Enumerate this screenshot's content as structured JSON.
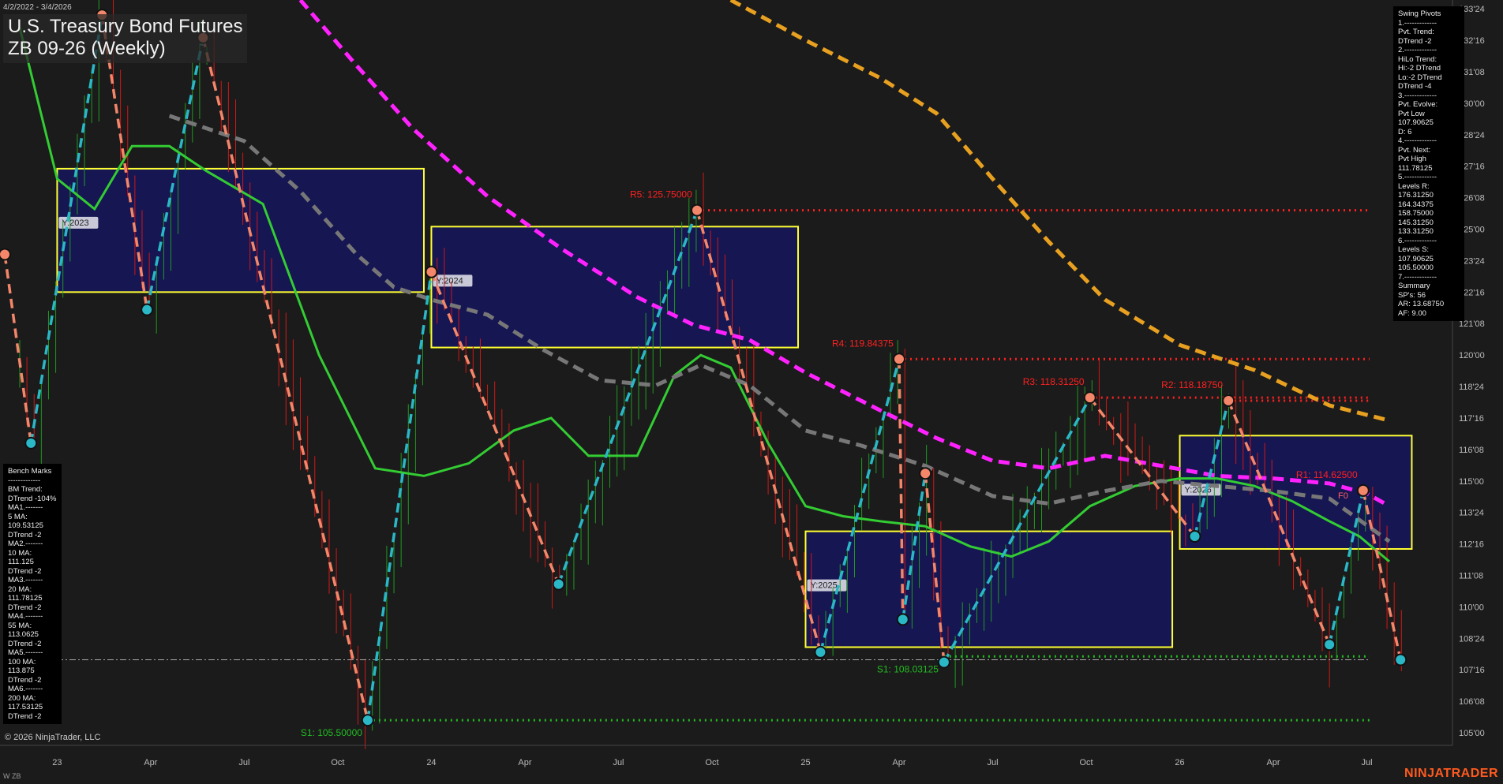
{
  "header": {
    "date_range": "4/2/2022 - 3/4/2026",
    "title_line1": "U.S. Treasury Bond Futures",
    "title_line2": "ZB 09-26 (Weekly)"
  },
  "swing_panel": {
    "lines": [
      "Swing Pivots",
      "1.-------------",
      "Pvt. Trend:",
      "DTrend -2",
      "2.-------------",
      "HiLo Trend:",
      "Hi:-2 DTrend",
      "Lo:-2 DTrend",
      "DTrend -4",
      "3.-------------",
      "Pvt. Evolve:",
      "Pvt Low",
      "107.90625",
      "D: 6",
      "4.-------------",
      "Pvt. Next:",
      "Pvt High",
      "111.78125",
      "5.-------------",
      "Levels R:",
      "176.31250",
      "164.34375",
      "158.75000",
      "145.31250",
      "133.31250",
      "6.-------------",
      "Levels S:",
      "107.90625",
      "105.50000",
      "7.-------------",
      "Summary",
      "SP's: 56",
      "AR: 13.68750",
      "AF: 9.00"
    ]
  },
  "bench_panel": {
    "lines": [
      "Bench Marks",
      "-------------",
      "BM Trend:",
      "DTrend -104%",
      "MA1.-------",
      "5 MA:",
      "109.53125",
      "DTrend -2",
      "MA2.-------",
      "10 MA:",
      "111.125",
      "DTrend -2",
      "MA3.-------",
      "20 MA:",
      "111.78125",
      "DTrend -2",
      "MA4.-------",
      "55 MA:",
      "113.0625",
      "DTrend -2",
      "MA5.-------",
      "100 MA:",
      "113.875",
      "DTrend -2",
      "MA6.-------",
      "200 MA:",
      "117.53125",
      "DTrend -2"
    ]
  },
  "footer": {
    "copyright": "© 2026 NinjaTrader, LLC",
    "instrument_code": "W ZB",
    "brand": "NINJATRADER"
  },
  "colors": {
    "background": "#1b1b1b",
    "up_swing": "#2ab7c6",
    "down_swing": "#f4866a",
    "ma_green": "#33cc33",
    "ma_gray": "#777777",
    "ma_magenta": "#ff22ff",
    "ma_orange": "#e8a020",
    "resistance": "#ff2020",
    "support": "#22bb22",
    "year_box": "#ffff33",
    "year_box_fill": "#16165a"
  },
  "chart_data": {
    "type": "line",
    "x_tick_labels": [
      "23",
      "Apr",
      "Jul",
      "Oct",
      "24",
      "Apr",
      "Jul",
      "Oct",
      "25",
      "Apr",
      "Jul",
      "Oct",
      "26",
      "Apr",
      "Jul"
    ],
    "y_tick_labels": [
      "133'24",
      "132'16",
      "131'08",
      "130'00",
      "128'24",
      "127'16",
      "126'08",
      "125'00",
      "123'24",
      "122'16",
      "121'08",
      "120'00",
      "118'24",
      "117'16",
      "116'08",
      "115'00",
      "113'24",
      "112'16",
      "111'08",
      "110'00",
      "108'24",
      "107'16",
      "106'08",
      "105'00"
    ],
    "ylim": [
      104.5,
      134.1
    ],
    "xlim": [
      2022.9,
      2026.56
    ],
    "swing_pivots": [
      {
        "x": 2022.86,
        "y": 124.0,
        "type": "high"
      },
      {
        "x": 2022.93,
        "y": 116.5,
        "type": "low"
      },
      {
        "x": 2023.12,
        "y": 133.5,
        "type": "high"
      },
      {
        "x": 2023.24,
        "y": 121.8,
        "type": "low"
      },
      {
        "x": 2023.39,
        "y": 132.6,
        "type": "high"
      },
      {
        "x": 2023.83,
        "y": 105.5,
        "type": "low"
      },
      {
        "x": 2024.0,
        "y": 123.3,
        "type": "high"
      },
      {
        "x": 2024.34,
        "y": 110.9,
        "type": "low"
      },
      {
        "x": 2024.71,
        "y": 125.75,
        "type": "high"
      },
      {
        "x": 2025.04,
        "y": 108.2,
        "type": "low"
      },
      {
        "x": 2025.25,
        "y": 119.84,
        "type": "high"
      },
      {
        "x": 2025.26,
        "y": 109.5,
        "type": "low"
      },
      {
        "x": 2025.32,
        "y": 115.3,
        "type": "high"
      },
      {
        "x": 2025.37,
        "y": 107.8,
        "type": "low"
      },
      {
        "x": 2025.76,
        "y": 118.31,
        "type": "high"
      },
      {
        "x": 2026.04,
        "y": 112.8,
        "type": "low"
      },
      {
        "x": 2026.13,
        "y": 118.19,
        "type": "high"
      },
      {
        "x": 2026.4,
        "y": 108.5,
        "type": "low"
      },
      {
        "x": 2026.49,
        "y": 114.62,
        "type": "high"
      },
      {
        "x": 2026.59,
        "y": 107.9,
        "type": "low"
      }
    ],
    "moving_averages": [
      {
        "name": "MA green",
        "color": "#33cc33",
        "dash": false,
        "points": [
          [
            2022.9,
            133
          ],
          [
            2023.0,
            127
          ],
          [
            2023.1,
            125.8
          ],
          [
            2023.2,
            128.3
          ],
          [
            2023.3,
            128.3
          ],
          [
            2023.4,
            127.3
          ],
          [
            2023.55,
            126.0
          ],
          [
            2023.7,
            120.0
          ],
          [
            2023.85,
            115.5
          ],
          [
            2023.98,
            115.2
          ],
          [
            2024.1,
            115.7
          ],
          [
            2024.22,
            117.0
          ],
          [
            2024.32,
            117.5
          ],
          [
            2024.42,
            116.0
          ],
          [
            2024.55,
            116.0
          ],
          [
            2024.65,
            119.2
          ],
          [
            2024.72,
            120.0
          ],
          [
            2024.8,
            119.5
          ],
          [
            2024.9,
            116.5
          ],
          [
            2025.0,
            114.0
          ],
          [
            2025.1,
            113.6
          ],
          [
            2025.2,
            113.4
          ],
          [
            2025.32,
            113.2
          ],
          [
            2025.44,
            112.4
          ],
          [
            2025.55,
            112.0
          ],
          [
            2025.65,
            112.6
          ],
          [
            2025.76,
            114.0
          ],
          [
            2025.88,
            114.8
          ],
          [
            2026.0,
            115.1
          ],
          [
            2026.1,
            115.1
          ],
          [
            2026.2,
            114.8
          ],
          [
            2026.3,
            114.2
          ],
          [
            2026.4,
            113.4
          ],
          [
            2026.48,
            112.8
          ],
          [
            2026.56,
            111.8
          ]
        ]
      },
      {
        "name": "MA gray",
        "color": "#777777",
        "dash": true,
        "points": [
          [
            2023.3,
            129.5
          ],
          [
            2023.5,
            128.5
          ],
          [
            2023.65,
            126.5
          ],
          [
            2023.8,
            124.0
          ],
          [
            2023.9,
            122.7
          ],
          [
            2024.0,
            122.2
          ],
          [
            2024.15,
            121.6
          ],
          [
            2024.3,
            120.2
          ],
          [
            2024.45,
            119.0
          ],
          [
            2024.6,
            118.8
          ],
          [
            2024.72,
            119.6
          ],
          [
            2024.85,
            118.8
          ],
          [
            2025.0,
            117.0
          ],
          [
            2025.15,
            116.4
          ],
          [
            2025.32,
            115.6
          ],
          [
            2025.5,
            114.4
          ],
          [
            2025.65,
            114.1
          ],
          [
            2025.8,
            114.6
          ],
          [
            2025.95,
            115.0
          ],
          [
            2026.1,
            114.8
          ],
          [
            2026.25,
            114.6
          ],
          [
            2026.4,
            114.3
          ],
          [
            2026.56,
            112.6
          ]
        ]
      },
      {
        "name": "MA magenta",
        "color": "#ff22ff",
        "dash": true,
        "points": [
          [
            2023.65,
            134.1
          ],
          [
            2023.8,
            131.5
          ],
          [
            2023.95,
            129.0
          ],
          [
            2024.15,
            126.3
          ],
          [
            2024.35,
            124.2
          ],
          [
            2024.55,
            122.3
          ],
          [
            2024.7,
            121.2
          ],
          [
            2024.85,
            120.6
          ],
          [
            2025.0,
            119.3
          ],
          [
            2025.2,
            117.8
          ],
          [
            2025.35,
            116.7
          ],
          [
            2025.5,
            115.8
          ],
          [
            2025.65,
            115.5
          ],
          [
            2025.8,
            116.0
          ],
          [
            2025.95,
            115.6
          ],
          [
            2026.1,
            115.2
          ],
          [
            2026.25,
            115.1
          ],
          [
            2026.4,
            114.9
          ],
          [
            2026.5,
            114.5
          ],
          [
            2026.56,
            114.0
          ]
        ]
      },
      {
        "name": "MA orange",
        "color": "#e8a020",
        "dash": true,
        "points": [
          [
            2024.8,
            134.1
          ],
          [
            2025.0,
            132.5
          ],
          [
            2025.2,
            131.0
          ],
          [
            2025.35,
            129.6
          ],
          [
            2025.5,
            127.0
          ],
          [
            2025.65,
            124.5
          ],
          [
            2025.8,
            122.2
          ],
          [
            2026.0,
            120.4
          ],
          [
            2026.2,
            119.4
          ],
          [
            2026.4,
            118.0
          ],
          [
            2026.56,
            117.4
          ]
        ]
      }
    ],
    "levels": [
      {
        "label": "R5: 125.75000",
        "value": 125.75,
        "type": "resistance",
        "x_start": 2024.71
      },
      {
        "label": "R4: 119.84375",
        "value": 119.84,
        "type": "resistance",
        "x_start": 2025.25
      },
      {
        "label": "R3: 118.31250",
        "value": 118.31,
        "type": "resistance",
        "x_start": 2025.76
      },
      {
        "label": "R2: 118.18750",
        "value": 118.19,
        "type": "resistance",
        "x_start": 2026.13
      },
      {
        "label": "R1: 114.62500",
        "value": 114.62,
        "type": "resistance",
        "x_start": 2026.49
      },
      {
        "label": "S1: 108.03125",
        "value": 108.03,
        "type": "support",
        "x_start": 2025.37
      },
      {
        "label": "S1: 105.50000",
        "value": 105.5,
        "type": "support",
        "x_start": 2023.83
      }
    ],
    "year_boxes": [
      {
        "label": "Y:2023",
        "x0": 2023.0,
        "x1": 2023.98,
        "y0": 122.5,
        "y1": 127.4
      },
      {
        "label": "Y:2024",
        "x0": 2024.0,
        "x1": 2024.98,
        "y0": 120.3,
        "y1": 125.1
      },
      {
        "label": "Y:2025",
        "x0": 2025.0,
        "x1": 2025.98,
        "y0": 108.4,
        "y1": 113.0
      },
      {
        "label": "Y:2026",
        "x0": 2026.0,
        "x1": 2026.62,
        "y0": 112.3,
        "y1": 116.8
      }
    ],
    "ref_line": {
      "label": "F0",
      "value": 107.9
    }
  }
}
